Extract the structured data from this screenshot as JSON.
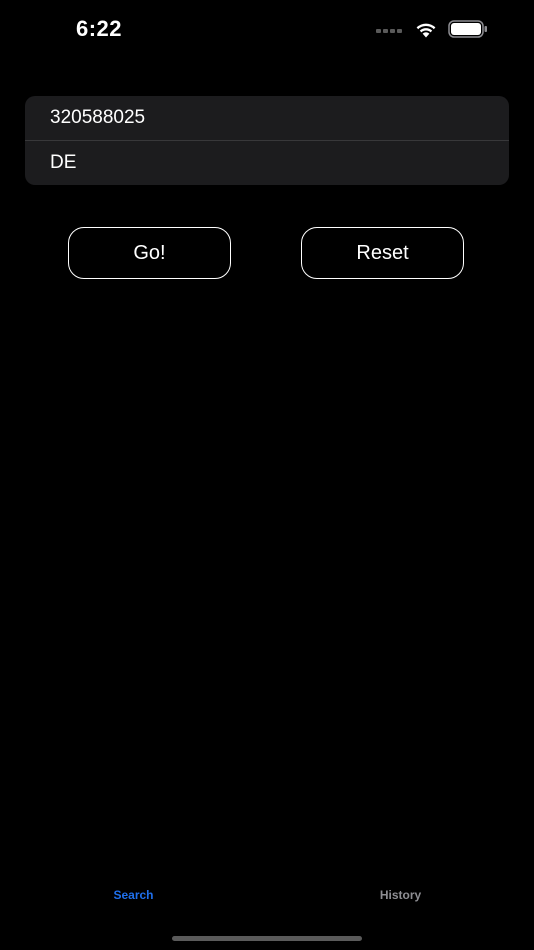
{
  "status_bar": {
    "time": "6:22"
  },
  "form": {
    "number_value": "320588025",
    "country_value": "DE"
  },
  "buttons": {
    "go_label": "Go!",
    "reset_label": "Reset"
  },
  "tab_bar": {
    "tabs": [
      {
        "label": "Search",
        "selected": true
      },
      {
        "label": "History",
        "selected": false
      }
    ]
  },
  "colors": {
    "background": "#000000",
    "field_background": "#1c1c1e",
    "accent": "#1f6feb",
    "inactive_tab": "#8e8e93"
  }
}
